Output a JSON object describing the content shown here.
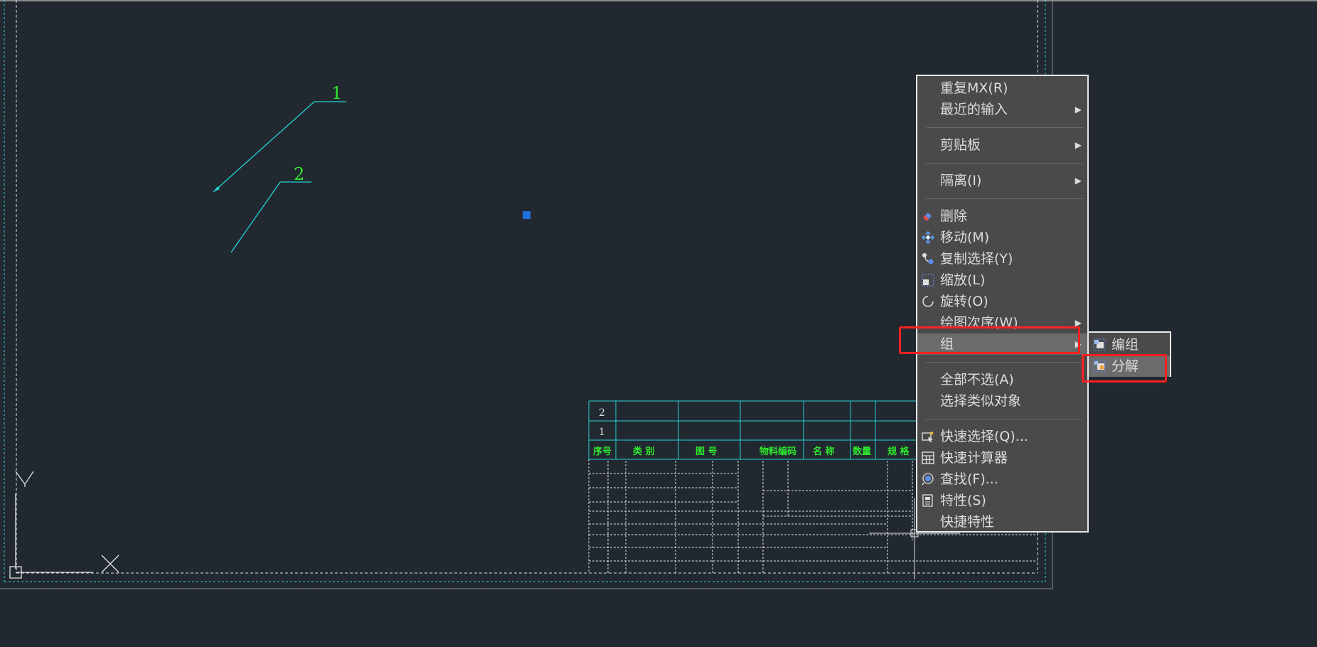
{
  "context_menu": {
    "items": [
      {
        "label": "重复MX(R)",
        "icon": null,
        "submenu": false
      },
      {
        "label": "最近的输入",
        "icon": null,
        "submenu": true
      },
      {
        "label": "剪贴板",
        "icon": null,
        "submenu": true
      },
      {
        "label": "隔离(I)",
        "icon": null,
        "submenu": true
      },
      {
        "label": "删除",
        "icon": "eraser-icon",
        "submenu": false
      },
      {
        "label": "移动(M)",
        "icon": "move-icon",
        "submenu": false
      },
      {
        "label": "复制选择(Y)",
        "icon": "copy-icon",
        "submenu": false
      },
      {
        "label": "缩放(L)",
        "icon": "scale-icon",
        "submenu": false
      },
      {
        "label": "旋转(O)",
        "icon": "rotate-icon",
        "submenu": false
      },
      {
        "label": "绘图次序(W)",
        "icon": null,
        "submenu": true
      },
      {
        "label": "组",
        "icon": null,
        "submenu": true,
        "highlighted": true
      },
      {
        "label": "全部不选(A)",
        "icon": null,
        "submenu": false
      },
      {
        "label": "选择类似对象",
        "icon": null,
        "submenu": false
      },
      {
        "label": "快速选择(Q)...",
        "icon": "quick-select-icon",
        "submenu": false
      },
      {
        "label": "快速计算器",
        "icon": "calculator-icon",
        "submenu": false
      },
      {
        "label": "查找(F)...",
        "icon": "find-icon",
        "submenu": false
      },
      {
        "label": "特性(S)",
        "icon": "properties-icon",
        "submenu": false
      },
      {
        "label": "快捷特性",
        "icon": null,
        "submenu": false
      }
    ]
  },
  "group_submenu": {
    "items": [
      {
        "label": "编组",
        "icon": "group-icon"
      },
      {
        "label": "分解",
        "icon": "ungroup-icon",
        "highlighted": true
      }
    ]
  },
  "drawing": {
    "leader_labels": [
      "1",
      "2"
    ]
  },
  "title_block": {
    "rows": [
      "2",
      "1"
    ],
    "headers": [
      "序号",
      "类  别",
      "图  号",
      "物料编码",
      "名  称",
      "数量",
      "规  格"
    ]
  },
  "colors": {
    "background": "#212830",
    "cyan": "#22d3d3",
    "green": "#2ee82e",
    "highlight_red": "#ff2020",
    "grip_blue": "#1e6fe0"
  }
}
